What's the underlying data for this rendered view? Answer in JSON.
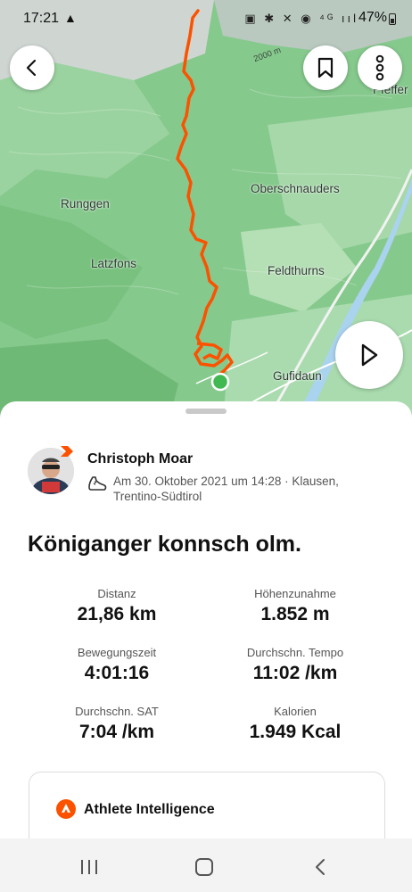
{
  "status_bar": {
    "time": "17:21",
    "icons": "▣ ✱ ✕ ◉ ⁴ᴳ ııl",
    "battery": "47%"
  },
  "map": {
    "places": {
      "runggen": "Runggen",
      "latzfons": "Latzfons",
      "oberschnauders": "Oberschnauders",
      "feldthurns": "Feldthurns",
      "gufidaun": "Gufidaun",
      "pfeffer": "Pfeffer"
    },
    "elevation_label": "2000 m",
    "route_color": "#fc5200",
    "start_marker_color": "#3fb950"
  },
  "buttons": {
    "back": "back",
    "bookmark": "bookmark",
    "more": "more",
    "play": "play"
  },
  "activity": {
    "athlete_name": "Christoph Moar",
    "meta": "Am 30. Oktober 2021 um 14:28 · Klausen, Trentino-Südtirol",
    "title": "Königanger konnsch olm.",
    "stats": {
      "distance": {
        "label": "Distanz",
        "value": "21,86 km"
      },
      "elevation": {
        "label": "Höhenzunahme",
        "value": "1.852 m"
      },
      "moving_time": {
        "label": "Bewegungszeit",
        "value": "4:01:16"
      },
      "pace": {
        "label": "Durchschn. Tempo",
        "value": "11:02 /km"
      },
      "gap": {
        "label": "Durchschn. SAT",
        "value": "7:04 /km"
      },
      "calories": {
        "label": "Kalorien",
        "value": "1.949 Kcal"
      }
    },
    "ai_card": {
      "title": "Athlete Intelligence"
    }
  }
}
